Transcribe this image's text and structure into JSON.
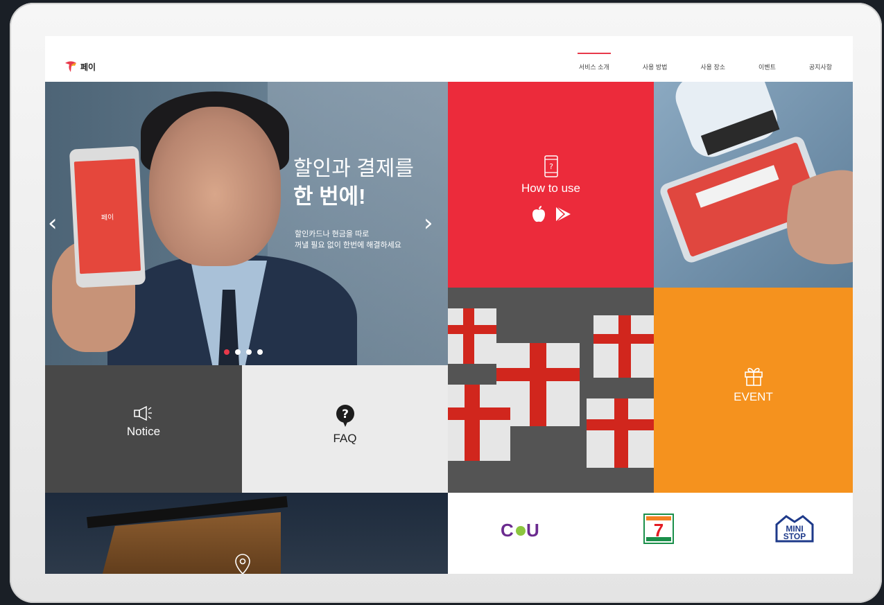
{
  "header": {
    "logo_text": "페이",
    "nav": [
      {
        "label": "서비스 소개",
        "active": true
      },
      {
        "label": "사용 방법",
        "active": false
      },
      {
        "label": "사용 장소",
        "active": false
      },
      {
        "label": "이벤트",
        "active": false
      },
      {
        "label": "공지사항",
        "active": false
      }
    ]
  },
  "hero": {
    "title_line1": "할인과 결제를",
    "title_line2": "한 번에!",
    "subtitle_line1": "할인카드나 현금을 따로",
    "subtitle_line2": "꺼낼 필요 없이 한번에 해결하세요",
    "phone_text": "페이",
    "prev_arrow": "‹",
    "next_arrow": "›",
    "slide_count": 4,
    "active_slide": 1
  },
  "tiles": {
    "howto_label": "How to use",
    "event_label": "EVENT",
    "notice_label": "Notice",
    "faq_label": "FAQ"
  },
  "brands": {
    "cu": "CU",
    "seven_eleven": "7",
    "ministop_line1": "MINI",
    "ministop_line2": "STOP"
  },
  "colors": {
    "accent_red": "#ec2b3b",
    "event_orange": "#f5921e",
    "notice_gray": "#484848",
    "faq_light": "#ebebeb"
  },
  "icons": [
    "phone-question-icon",
    "apple-icon",
    "google-play-icon",
    "gift-icon",
    "megaphone-icon",
    "question-bubble-icon",
    "location-pin-icon"
  ]
}
